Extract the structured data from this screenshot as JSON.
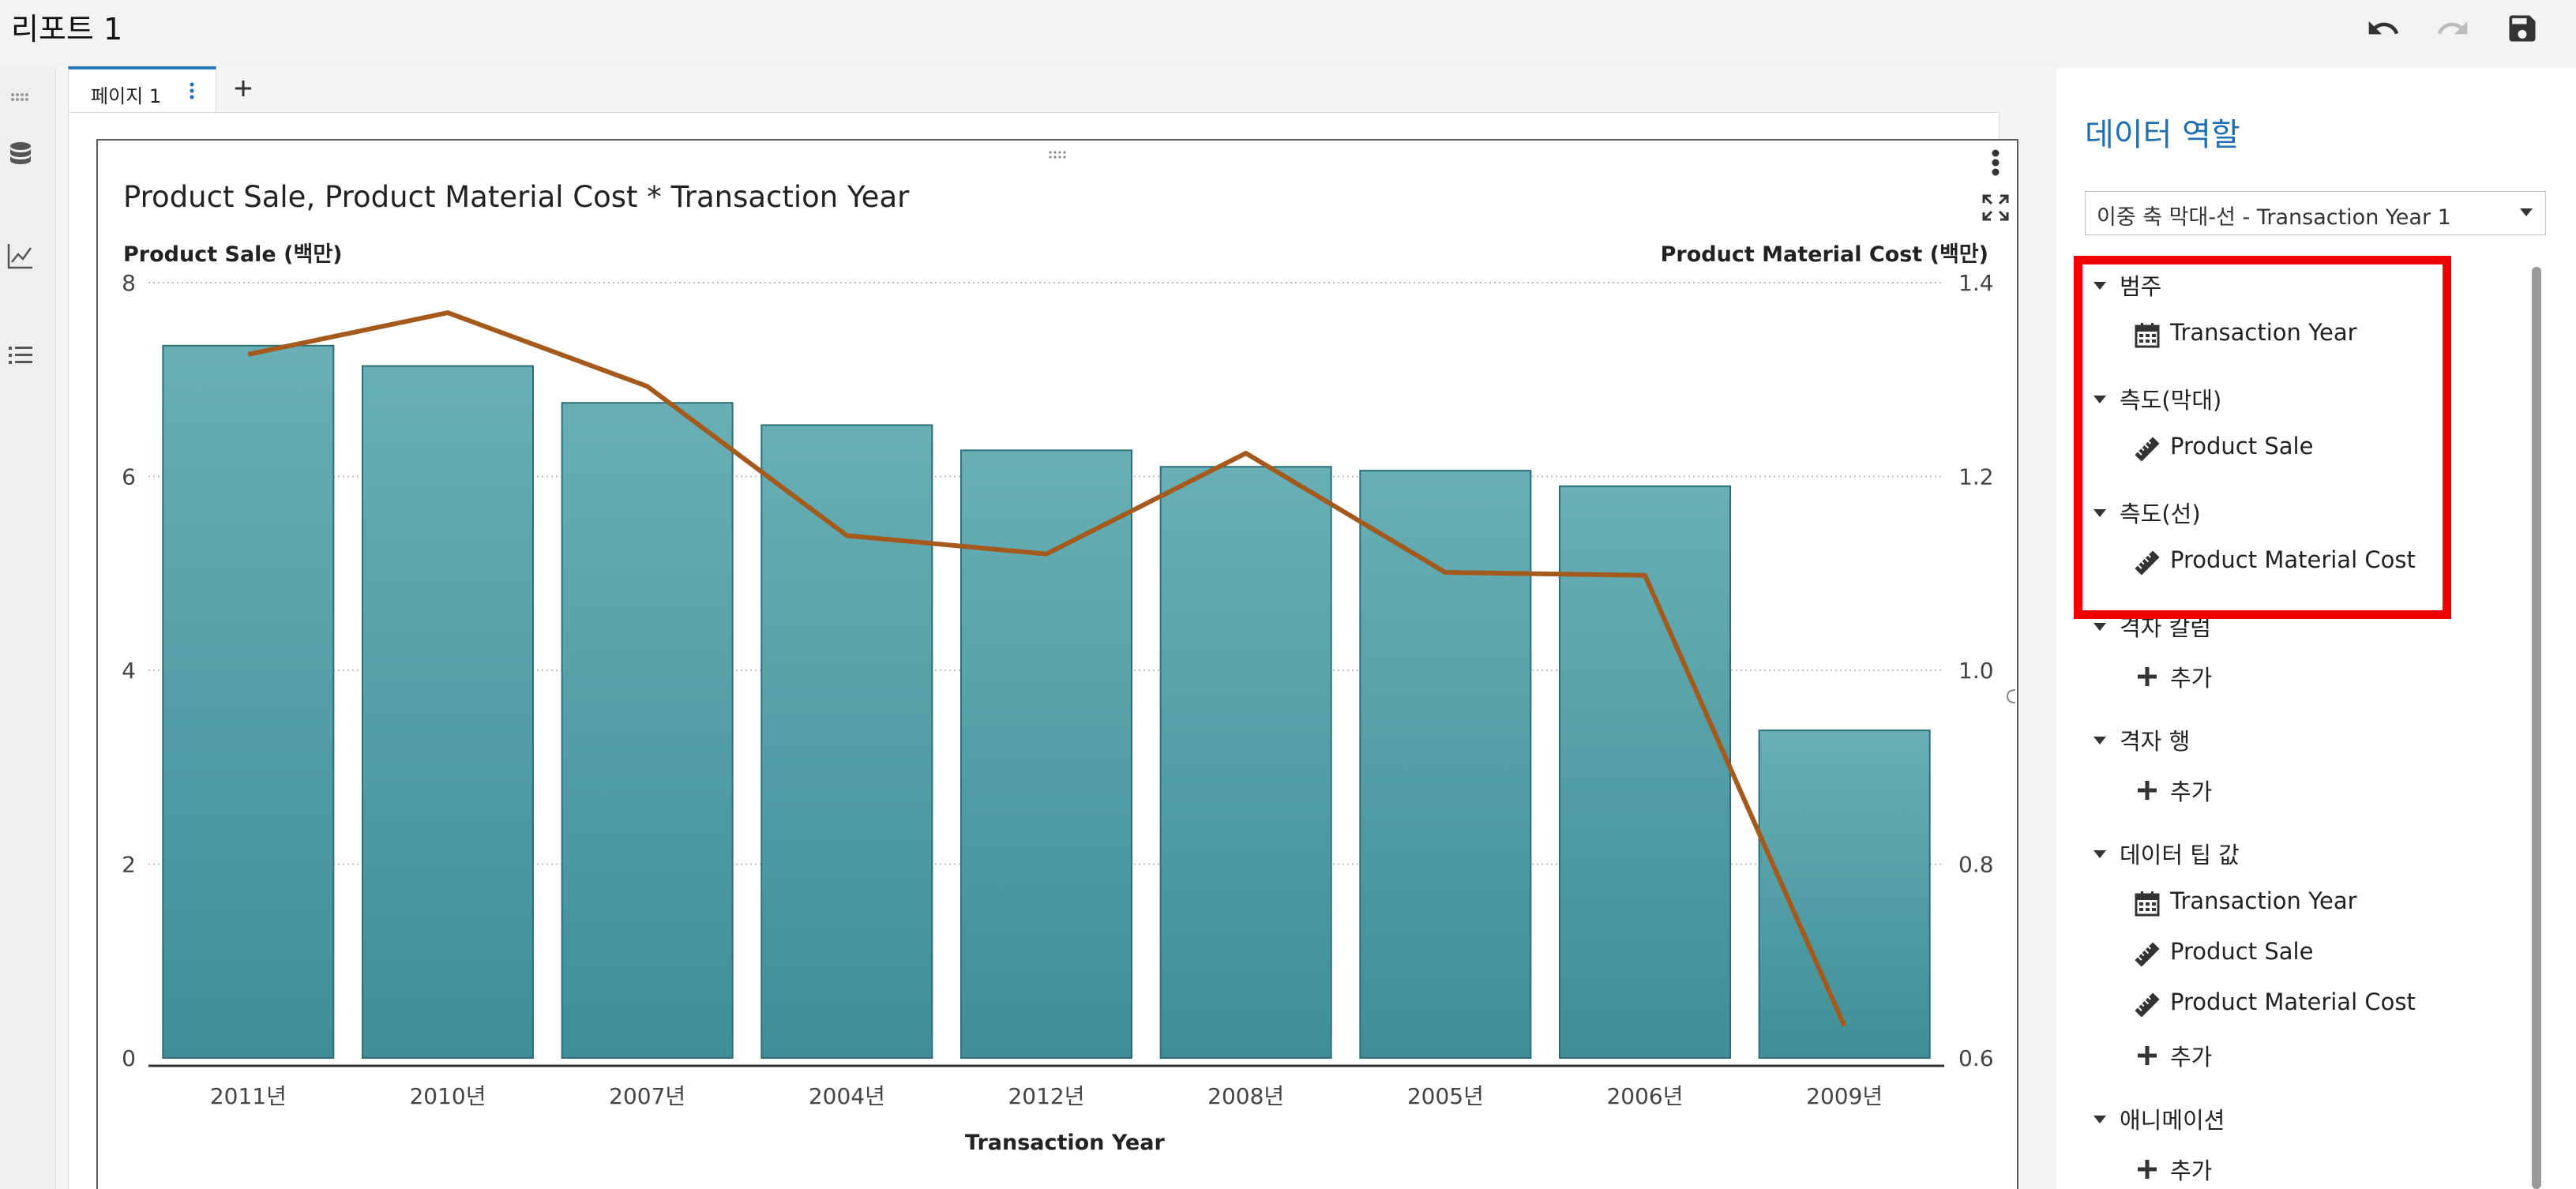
{
  "app": {
    "title": "리포트 1"
  },
  "page_tabs": [
    {
      "label": "페이지 1"
    }
  ],
  "chart_data": {
    "type": "bar",
    "title": "Product Sale, Product Material Cost * Transaction Year",
    "xlabel": "Transaction Year",
    "ylabel": "Product Sale (백만)",
    "y2label": "Product Material Cost (백만)",
    "categories": [
      "2011년",
      "2010년",
      "2007년",
      "2004년",
      "2012년",
      "2008년",
      "2005년",
      "2006년",
      "2009년"
    ],
    "ylim": [
      0,
      8
    ],
    "y_ticks": [
      "0",
      "2",
      "4",
      "6",
      "8"
    ],
    "y2lim": [
      0.6,
      1.4
    ],
    "y2_ticks": [
      "0.6",
      "0.8",
      "1.0",
      "1.2",
      "1.4"
    ],
    "series": [
      {
        "name": "Product Sale",
        "type": "bar",
        "axis": "left",
        "color": "#4a9ba4",
        "values": [
          7.35,
          7.14,
          6.76,
          6.53,
          6.27,
          6.1,
          6.06,
          5.9,
          3.38
        ]
      },
      {
        "name": "Product Material Cost",
        "type": "line",
        "axis": "right",
        "color": "#a35a1c",
        "values": [
          1.326,
          1.369,
          1.293,
          1.139,
          1.12,
          1.224,
          1.101,
          1.098,
          0.633
        ]
      }
    ],
    "grid": true
  },
  "panel": {
    "title": "데이터 역할",
    "dropdown_value": "이중 축 막대-선 - Transaction Year 1",
    "sections": [
      {
        "label": "범주",
        "items": [
          {
            "icon": "calendar-icon",
            "label": "Transaction Year"
          }
        ]
      },
      {
        "label": "측도(막대)",
        "items": [
          {
            "icon": "ruler-icon",
            "label": "Product Sale"
          }
        ]
      },
      {
        "label": "측도(선)",
        "items": [
          {
            "icon": "ruler-icon",
            "label": "Product Material Cost"
          }
        ]
      },
      {
        "label": "격자 칼럼",
        "items": [
          {
            "icon": "plus-icon",
            "label": "추가"
          }
        ]
      },
      {
        "label": "격자 행",
        "items": [
          {
            "icon": "plus-icon",
            "label": "추가"
          }
        ]
      },
      {
        "label": "데이터 팁 값",
        "items": [
          {
            "icon": "calendar-icon",
            "label": "Transaction Year"
          },
          {
            "icon": "ruler-icon",
            "label": "Product Sale"
          },
          {
            "icon": "ruler-icon",
            "label": "Product Material Cost"
          },
          {
            "icon": "plus-icon",
            "label": "추가"
          }
        ]
      },
      {
        "label": "애니메이션",
        "items": [
          {
            "icon": "plus-icon",
            "label": "추가"
          }
        ]
      }
    ]
  },
  "colors": {
    "accent": "#1f6fb2",
    "highlight": "#f20000"
  }
}
